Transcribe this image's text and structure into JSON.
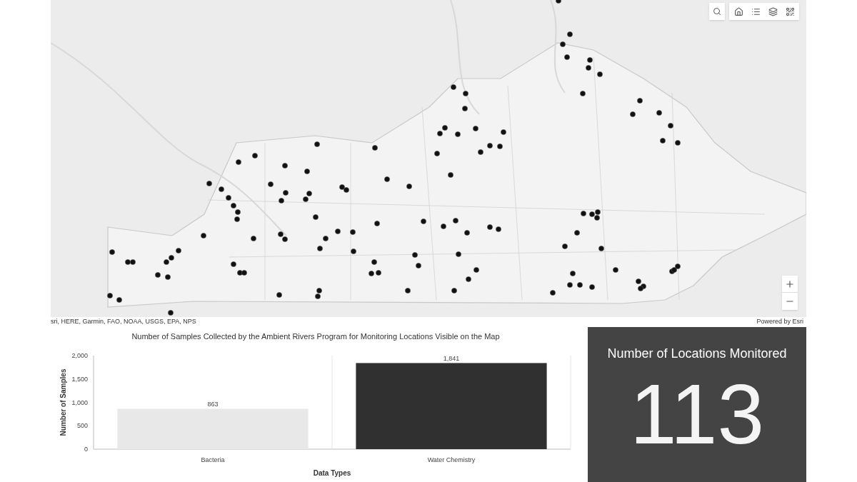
{
  "map": {
    "attribution": "sri, HERE, Garmin, FAO, NOAA, USGS, EPA, NPS",
    "powered_by": "Powered by Esri"
  },
  "chart": {
    "title": "Number of Samples Collected by the Ambient Rivers Program for Monitoring Locations Visible on the Map",
    "chart_data": {
      "type": "bar",
      "xlabel": "Data Types",
      "ylabel": "Number of Samples",
      "categories": [
        "Bacteria",
        "Water Chemistry"
      ],
      "series": [
        {
          "values": [
            863,
            1841
          ]
        }
      ],
      "ylim": [
        0,
        2000
      ],
      "yticks": [
        {
          "value": 0,
          "label": "0"
        },
        {
          "value": 500,
          "label": "500"
        },
        {
          "value": 1000,
          "label": "1,000"
        },
        {
          "value": 1500,
          "label": "1,500"
        },
        {
          "value": 2000,
          "label": "2,000"
        }
      ],
      "value_labels": [
        "863",
        "1,841"
      ]
    }
  },
  "indicator": {
    "title": "Number of Locations Monitored",
    "value": "113"
  }
}
